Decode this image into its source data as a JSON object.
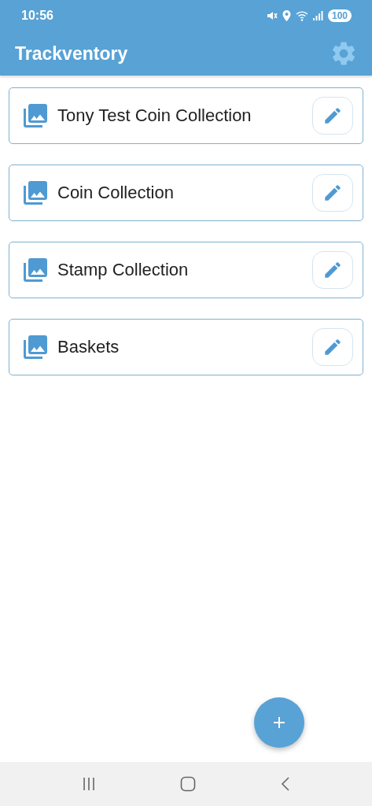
{
  "status_bar": {
    "time": "10:56",
    "battery": "100"
  },
  "app_bar": {
    "title": "Trackventory"
  },
  "collections": [
    {
      "name": "Tony Test Coin Collection"
    },
    {
      "name": "Coin Collection"
    },
    {
      "name": "Stamp Collection"
    },
    {
      "name": "Baskets"
    }
  ]
}
